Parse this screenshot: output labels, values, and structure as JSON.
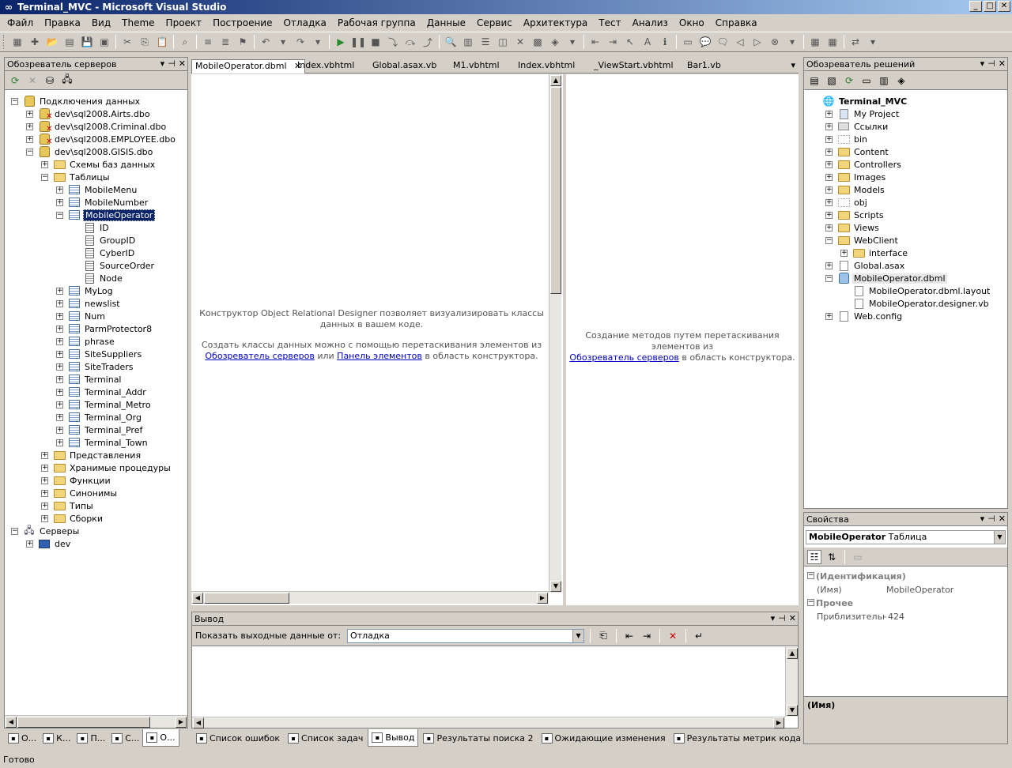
{
  "window": {
    "title": "Terminal_MVC - Microsoft Visual Studio",
    "min": "_",
    "max": "□",
    "close": "✕"
  },
  "menu": [
    "Файл",
    "Правка",
    "Вид",
    "Theme",
    "Проект",
    "Построение",
    "Отладка",
    "Рабочая группа",
    "Данные",
    "Сервис",
    "Архитектура",
    "Тест",
    "Анализ",
    "Окно",
    "Справка"
  ],
  "server_explorer": {
    "title": "Обозреватель серверов",
    "tree": [
      {
        "label": "Подключения данных",
        "level": 0,
        "exp": "-",
        "icon": "db-folder"
      },
      {
        "label": "dev\\sql2008.Airts.dbo",
        "level": 1,
        "exp": "+",
        "icon": "db-error"
      },
      {
        "label": "dev\\sql2008.Criminal.dbo",
        "level": 1,
        "exp": "+",
        "icon": "db-error"
      },
      {
        "label": "dev\\sql2008.EMPLOYEE.dbo",
        "level": 1,
        "exp": "+",
        "icon": "db-error"
      },
      {
        "label": "dev\\sql2008.GISIS.dbo",
        "level": 1,
        "exp": "-",
        "icon": "db"
      },
      {
        "label": "Схемы баз данных",
        "level": 2,
        "exp": "+",
        "icon": "folder"
      },
      {
        "label": "Таблицы",
        "level": 2,
        "exp": "-",
        "icon": "folder"
      },
      {
        "label": "MobileMenu",
        "level": 3,
        "exp": "+",
        "icon": "table"
      },
      {
        "label": "MobileNumber",
        "level": 3,
        "exp": "+",
        "icon": "table"
      },
      {
        "label": "MobileOperator",
        "level": 3,
        "exp": "-",
        "icon": "table",
        "selected": true
      },
      {
        "label": "ID",
        "level": 4,
        "exp": "",
        "icon": "column"
      },
      {
        "label": "GroupID",
        "level": 4,
        "exp": "",
        "icon": "column"
      },
      {
        "label": "CyberID",
        "level": 4,
        "exp": "",
        "icon": "column"
      },
      {
        "label": "SourceOrder",
        "level": 4,
        "exp": "",
        "icon": "column"
      },
      {
        "label": "Node",
        "level": 4,
        "exp": "",
        "icon": "column"
      },
      {
        "label": "MyLog",
        "level": 3,
        "exp": "+",
        "icon": "table"
      },
      {
        "label": "newslist",
        "level": 3,
        "exp": "+",
        "icon": "table"
      },
      {
        "label": "Num",
        "level": 3,
        "exp": "+",
        "icon": "table"
      },
      {
        "label": "ParmProtector8",
        "level": 3,
        "exp": "+",
        "icon": "table"
      },
      {
        "label": "phrase",
        "level": 3,
        "exp": "+",
        "icon": "table"
      },
      {
        "label": "SiteSuppliers",
        "level": 3,
        "exp": "+",
        "icon": "table"
      },
      {
        "label": "SiteTraders",
        "level": 3,
        "exp": "+",
        "icon": "table"
      },
      {
        "label": "Terminal",
        "level": 3,
        "exp": "+",
        "icon": "table"
      },
      {
        "label": "Terminal_Addr",
        "level": 3,
        "exp": "+",
        "icon": "table"
      },
      {
        "label": "Terminal_Metro",
        "level": 3,
        "exp": "+",
        "icon": "table"
      },
      {
        "label": "Terminal_Org",
        "level": 3,
        "exp": "+",
        "icon": "table"
      },
      {
        "label": "Terminal_Pref",
        "level": 3,
        "exp": "+",
        "icon": "table"
      },
      {
        "label": "Terminal_Town",
        "level": 3,
        "exp": "+",
        "icon": "table"
      },
      {
        "label": "Представления",
        "level": 2,
        "exp": "+",
        "icon": "folder"
      },
      {
        "label": "Хранимые процедуры",
        "level": 2,
        "exp": "+",
        "icon": "folder"
      },
      {
        "label": "Функции",
        "level": 2,
        "exp": "+",
        "icon": "folder"
      },
      {
        "label": "Синонимы",
        "level": 2,
        "exp": "+",
        "icon": "folder"
      },
      {
        "label": "Типы",
        "level": 2,
        "exp": "+",
        "icon": "folder"
      },
      {
        "label": "Сборки",
        "level": 2,
        "exp": "+",
        "icon": "folder"
      },
      {
        "label": "Серверы",
        "level": 0,
        "exp": "-",
        "icon": "servers"
      },
      {
        "label": "dev",
        "level": 1,
        "exp": "+",
        "icon": "computer"
      }
    ]
  },
  "tabs": [
    "MobileOperator.dbml",
    "Index.vbhtml",
    "Global.asax.vb",
    "M1.vbhtml",
    "Index.vbhtml",
    "_ViewStart.vbhtml",
    "Bar1.vb"
  ],
  "designer": {
    "left_hint_1": "Конструктор Object Relational Designer позволяет визуализировать классы данных в вашем коде.",
    "left_hint_2_pre": "Создать классы данных можно с помощью перетаскивания элементов из",
    "link_servers": "Обозреватель серверов",
    "or": "или",
    "link_toolbox": "Панель элементов",
    "left_hint_2_post": "в область конструктора.",
    "right_hint_pre": "Создание методов путем перетаскивания элементов из",
    "right_hint_post": "в область конструктора."
  },
  "output": {
    "title": "Вывод",
    "show_label": "Показать выходные данные от:",
    "source": "Отладка"
  },
  "solution_explorer": {
    "title": "Обозреватель решений",
    "tree": [
      {
        "label": "Terminal_MVC",
        "level": 0,
        "exp": "",
        "icon": "project",
        "bold": true
      },
      {
        "label": "My Project",
        "level": 1,
        "exp": "+",
        "icon": "myproject"
      },
      {
        "label": "Ссылки",
        "level": 1,
        "exp": "+",
        "icon": "refs"
      },
      {
        "label": "bin",
        "level": 1,
        "exp": "+",
        "icon": "folder-empty"
      },
      {
        "label": "Content",
        "level": 1,
        "exp": "+",
        "icon": "folder"
      },
      {
        "label": "Controllers",
        "level": 1,
        "exp": "+",
        "icon": "folder"
      },
      {
        "label": "Images",
        "level": 1,
        "exp": "+",
        "icon": "folder"
      },
      {
        "label": "Models",
        "level": 1,
        "exp": "+",
        "icon": "folder"
      },
      {
        "label": "obj",
        "level": 1,
        "exp": "+",
        "icon": "folder-empty"
      },
      {
        "label": "Scripts",
        "level": 1,
        "exp": "+",
        "icon": "folder"
      },
      {
        "label": "Views",
        "level": 1,
        "exp": "+",
        "icon": "folder"
      },
      {
        "label": "WebClient",
        "level": 1,
        "exp": "-",
        "icon": "folder"
      },
      {
        "label": "interface",
        "level": 2,
        "exp": "+",
        "icon": "folder"
      },
      {
        "label": "Global.asax",
        "level": 1,
        "exp": "+",
        "icon": "file"
      },
      {
        "label": "MobileOperator.dbml",
        "level": 1,
        "exp": "-",
        "icon": "dbml",
        "hl": true
      },
      {
        "label": "MobileOperator.dbml.layout",
        "level": 2,
        "exp": "",
        "icon": "file"
      },
      {
        "label": "MobileOperator.designer.vb",
        "level": 2,
        "exp": "",
        "icon": "file"
      },
      {
        "label": "Web.config",
        "level": 1,
        "exp": "+",
        "icon": "file"
      }
    ]
  },
  "properties": {
    "title": "Свойства",
    "object_name": "MobileOperator",
    "object_type": "Таблица",
    "cat1": "(Идентификация)",
    "row1_name": "(Имя)",
    "row1_value": "MobileOperator",
    "cat2": "Прочее",
    "row2_name": "Приблизительное ч",
    "row2_value": "424",
    "desc_title": "(Имя)"
  },
  "left_bottom_tabs": [
    "О...",
    "К...",
    "П...",
    "С...",
    "О..."
  ],
  "bottom_tabs": [
    "Список ошибок",
    "Список задач",
    "Вывод",
    "Результаты поиска 2",
    "Ожидающие изменения",
    "Результаты метрик кода"
  ],
  "status": "Готово"
}
